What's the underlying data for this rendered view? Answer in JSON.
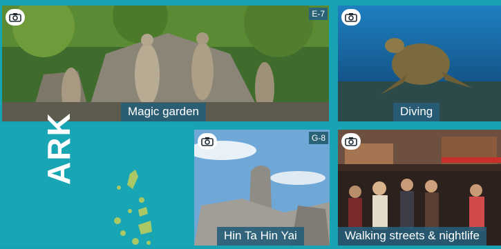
{
  "tiles": {
    "magic_garden": {
      "caption": "Magic garden",
      "grid_ref": "E-7",
      "icon": "camera-icon"
    },
    "diving": {
      "caption": "Diving",
      "icon": "camera-icon"
    },
    "hin_ta_hin_yai": {
      "caption": "Hin Ta Hin Yai",
      "grid_ref": "G-8",
      "icon": "camera-icon"
    },
    "walking_streets": {
      "caption": "Walking streets & nightlife",
      "icon": "camera-icon"
    }
  },
  "map": {
    "visible_word": "ARK"
  },
  "colors": {
    "background": "#17a3b3",
    "caption_bg": "#265d78",
    "grid_ref_bg": "#2a6378",
    "island_green": "#a9c865"
  }
}
